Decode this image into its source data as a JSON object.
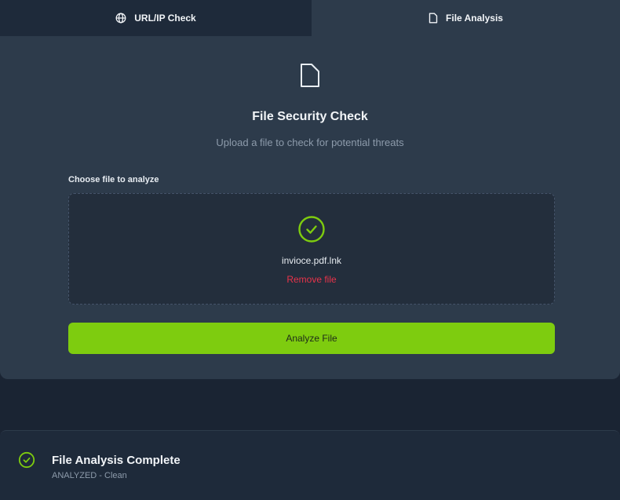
{
  "tabs": [
    {
      "label": "URL/IP Check",
      "icon": "globe-icon",
      "active": false
    },
    {
      "label": "File Analysis",
      "icon": "file-icon",
      "active": true
    }
  ],
  "card": {
    "icon": "file-icon",
    "title": "File Security Check",
    "subtitle": "Upload a file to check for potential threats",
    "field_label": "Choose file to analyze",
    "dropzone": {
      "icon": "check-circle-icon",
      "filename": "invioce.pdf.lnk",
      "remove_label": "Remove file"
    },
    "analyze_label": "Analyze File"
  },
  "result": {
    "icon": "check-circle-icon",
    "title": "File Analysis Complete",
    "status": "ANALYZED - Clean"
  },
  "colors": {
    "accent": "#7ecc0f",
    "danger": "#e8334a",
    "card_bg": "#2d3b4b",
    "page_bg": "#1a2433"
  }
}
